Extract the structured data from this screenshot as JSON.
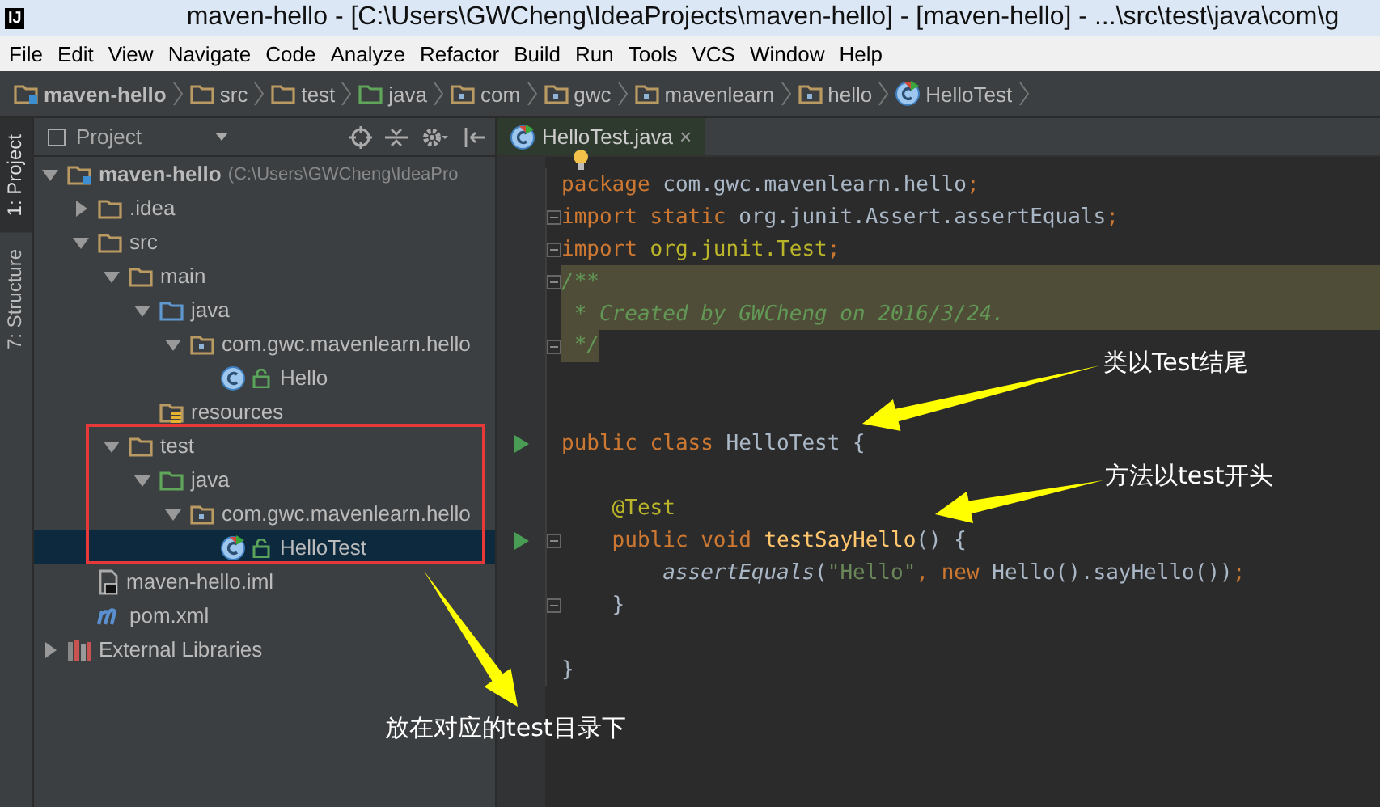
{
  "window": {
    "app_icon": "IJ",
    "title": "maven-hello - [C:\\Users\\GWCheng\\IdeaProjects\\maven-hello] - [maven-hello] - ...\\src\\test\\java\\com\\g"
  },
  "menu": [
    "File",
    "Edit",
    "View",
    "Navigate",
    "Code",
    "Analyze",
    "Refactor",
    "Build",
    "Run",
    "Tools",
    "VCS",
    "Window",
    "Help"
  ],
  "breadcrumbs": [
    {
      "label": "maven-hello",
      "kind": "module"
    },
    {
      "label": "src",
      "kind": "folder"
    },
    {
      "label": "test",
      "kind": "folder"
    },
    {
      "label": "java",
      "kind": "test-folder"
    },
    {
      "label": "com",
      "kind": "package"
    },
    {
      "label": "gwc",
      "kind": "package"
    },
    {
      "label": "mavenlearn",
      "kind": "package"
    },
    {
      "label": "hello",
      "kind": "package"
    },
    {
      "label": "HelloTest",
      "kind": "test-class"
    }
  ],
  "tool_strip": [
    {
      "label": "1: Project",
      "selected": true
    },
    {
      "label": "7: Structure",
      "selected": false
    }
  ],
  "project_panel": {
    "title": "Project",
    "tree": [
      {
        "label": "maven-hello",
        "path": "(C:\\Users\\GWCheng\\IdeaPro",
        "kind": "module",
        "expanded": true,
        "selected": false,
        "children": [
          {
            "label": ".idea",
            "kind": "folder",
            "expanded": false,
            "selected": false
          },
          {
            "label": "src",
            "kind": "folder",
            "expanded": true,
            "selected": false,
            "children": [
              {
                "label": "main",
                "kind": "folder",
                "expanded": true,
                "selected": false,
                "children": [
                  {
                    "label": "java",
                    "kind": "source-folder",
                    "expanded": true,
                    "selected": false,
                    "children": [
                      {
                        "label": "com.gwc.mavenlearn.hello",
                        "kind": "package",
                        "expanded": true,
                        "selected": false,
                        "children": [
                          {
                            "label": "Hello",
                            "kind": "class",
                            "selected": false
                          }
                        ]
                      }
                    ]
                  },
                  {
                    "label": "resources",
                    "kind": "resources",
                    "selected": false
                  }
                ]
              },
              {
                "label": "test",
                "kind": "folder",
                "expanded": true,
                "selected": false,
                "children": [
                  {
                    "label": "java",
                    "kind": "test-folder",
                    "expanded": true,
                    "selected": false,
                    "children": [
                      {
                        "label": "com.gwc.mavenlearn.hello",
                        "kind": "package",
                        "expanded": true,
                        "selected": false,
                        "children": [
                          {
                            "label": "HelloTest",
                            "kind": "test-class",
                            "selected": true
                          }
                        ]
                      }
                    ]
                  }
                ]
              }
            ]
          },
          {
            "label": "maven-hello.iml",
            "kind": "iml",
            "selected": false
          },
          {
            "label": "pom.xml",
            "kind": "maven",
            "selected": false
          }
        ]
      },
      {
        "label": "External Libraries",
        "kind": "libraries",
        "expanded": false,
        "selected": false
      }
    ]
  },
  "editor": {
    "tabs": [
      {
        "label": "HelloTest.java",
        "close": "×",
        "selected": true
      }
    ],
    "lines": [
      {
        "run": false,
        "fold": false,
        "highlighted": false,
        "tokens": [
          {
            "text": "package ",
            "kind": "keyword"
          },
          {
            "text": "com.gwc.mavenlearn.hello",
            "kind": "plain"
          },
          {
            "text": ";",
            "kind": "keyword"
          }
        ]
      },
      {
        "run": false,
        "fold": true,
        "highlighted": false,
        "tokens": [
          {
            "text": "import static ",
            "kind": "keyword"
          },
          {
            "text": "org.junit.Assert.assertEquals",
            "kind": "plain"
          },
          {
            "text": ";",
            "kind": "keyword"
          }
        ]
      },
      {
        "run": false,
        "fold": true,
        "highlighted": false,
        "tokens": [
          {
            "text": "import ",
            "kind": "keyword"
          },
          {
            "text": "org.junit.Test",
            "kind": "annotation"
          },
          {
            "text": ";",
            "kind": "keyword"
          }
        ]
      },
      {
        "run": false,
        "fold": true,
        "highlighted": true,
        "tokens": [
          {
            "text": "/**",
            "kind": "comment"
          }
        ]
      },
      {
        "run": false,
        "fold": false,
        "highlighted": true,
        "tokens": [
          {
            "text": " * Created by GWCheng on 2016/3/24.",
            "kind": "comment"
          }
        ]
      },
      {
        "run": false,
        "fold": true,
        "highlighted": true,
        "tokens": [
          {
            "text": " */",
            "kind": "comment"
          }
        ]
      },
      {
        "run": false,
        "fold": false,
        "highlighted": false
      },
      {
        "run": false,
        "fold": false,
        "highlighted": false
      },
      {
        "run": true,
        "fold": false,
        "highlighted": false,
        "tokens": [
          {
            "text": "public class ",
            "kind": "keyword"
          },
          {
            "text": "HelloTest {",
            "kind": "plain"
          }
        ]
      },
      {
        "run": false,
        "fold": false,
        "highlighted": false
      },
      {
        "run": false,
        "fold": false,
        "highlighted": false,
        "tokens": [
          {
            "text": "    @Test",
            "kind": "annotation"
          }
        ]
      },
      {
        "run": true,
        "fold": true,
        "highlighted": false,
        "tokens": [
          {
            "text": "    public void ",
            "kind": "keyword"
          },
          {
            "text": "testSayHello",
            "kind": "method"
          },
          {
            "text": "() {",
            "kind": "plain"
          }
        ]
      },
      {
        "run": false,
        "fold": false,
        "highlighted": false,
        "tokens": [
          {
            "text": "        assertEquals",
            "kind": "static-call"
          },
          {
            "text": "(",
            "kind": "plain"
          },
          {
            "text": "\"Hello\"",
            "kind": "string"
          },
          {
            "text": ", new ",
            "kind": "keyword"
          },
          {
            "text": "Hello().sayHello())",
            "kind": "plain"
          },
          {
            "text": ";",
            "kind": "keyword"
          }
        ]
      },
      {
        "run": false,
        "fold": true,
        "highlighted": false,
        "tokens": [
          {
            "text": "    }",
            "kind": "plain"
          }
        ]
      },
      {
        "run": false,
        "fold": false,
        "highlighted": false
      },
      {
        "run": false,
        "fold": false,
        "highlighted": false,
        "tokens": [
          {
            "text": "}",
            "kind": "plain"
          }
        ]
      }
    ]
  },
  "annotations": [
    {
      "text": "类以Test结尾"
    },
    {
      "text": "方法以test开头"
    },
    {
      "text": "放在对应的test目录下"
    }
  ]
}
